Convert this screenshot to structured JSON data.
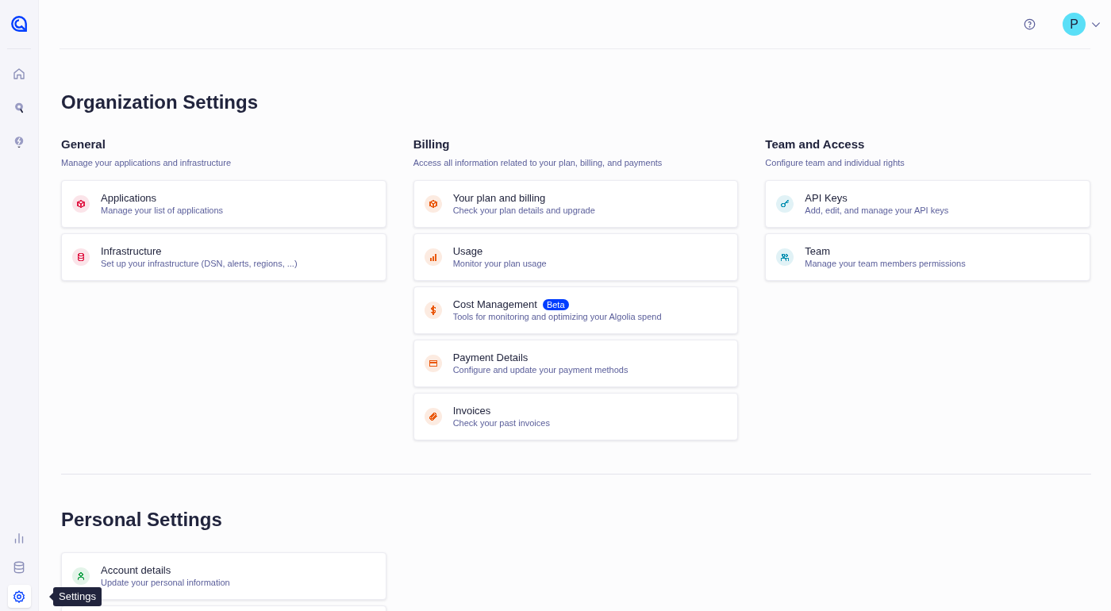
{
  "sidebar": {
    "top_items": [
      {
        "kind": "home",
        "selected": false
      },
      {
        "kind": "discover",
        "selected": false
      },
      {
        "kind": "insight",
        "selected": false
      }
    ],
    "bottom_items": [
      {
        "kind": "analytics",
        "selected": false
      },
      {
        "kind": "data",
        "selected": false
      },
      {
        "kind": "settings",
        "selected": true
      }
    ],
    "tooltip": "Settings"
  },
  "header": {
    "avatar": "P"
  },
  "organization": {
    "title": "Organization Settings",
    "sections": [
      {
        "title": "General",
        "description": "Manage your applications and infrastructure",
        "color": "#e11d48",
        "cards": [
          {
            "kind": "cube",
            "title": "Applications",
            "subtitle": "Manage your list of applications"
          },
          {
            "kind": "database",
            "title": "Infrastructure",
            "subtitle": "Set up your infrastructure (DSN, alerts, regions, ...)"
          }
        ]
      },
      {
        "title": "Billing",
        "description": "Access all information related to your plan, billing, and payments",
        "color": "#ea580c",
        "cards": [
          {
            "kind": "cube",
            "title": "Your plan and billing",
            "subtitle": "Check your plan details and upgrade"
          },
          {
            "kind": "chart",
            "title": "Usage",
            "subtitle": "Monitor your plan usage"
          },
          {
            "kind": "dollar",
            "title": "Cost Management",
            "badge": "Beta",
            "subtitle": "Tools for monitoring and optimizing your Algolia spend"
          },
          {
            "kind": "card",
            "title": "Payment Details",
            "subtitle": "Configure and update your payment methods"
          },
          {
            "kind": "clip",
            "title": "Invoices",
            "subtitle": "Check your past invoices"
          }
        ]
      },
      {
        "title": "Team and Access",
        "description": "Configure team and individual rights",
        "color": "#0891b2",
        "cards": [
          {
            "kind": "key",
            "title": "API Keys",
            "subtitle": "Add, edit, and manage your API keys"
          },
          {
            "kind": "team",
            "title": "Team",
            "subtitle": "Manage your team members permissions"
          }
        ]
      }
    ]
  },
  "personal": {
    "title": "Personal Settings",
    "color": "#16a34a",
    "cards": [
      {
        "kind": "user",
        "title": "Account details",
        "subtitle": "Update your personal information"
      }
    ]
  }
}
